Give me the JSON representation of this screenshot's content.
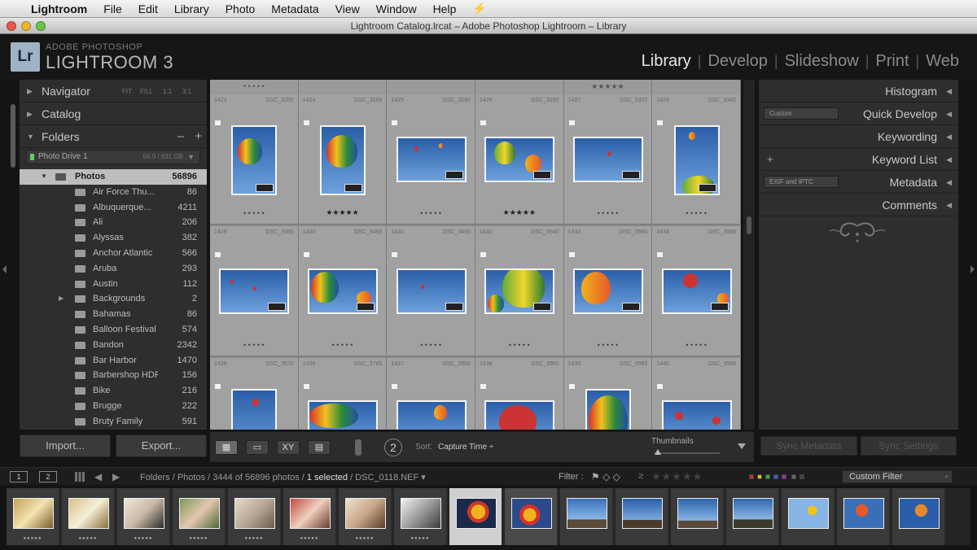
{
  "menubar": {
    "apple": "",
    "items": [
      "Lightroom",
      "File",
      "Edit",
      "Library",
      "Photo",
      "Metadata",
      "View",
      "Window",
      "Help"
    ],
    "extra": "⚡"
  },
  "window": {
    "title": "Lightroom Catalog.lrcat – Adobe Photoshop Lightroom – Library"
  },
  "identity": {
    "badge": "Lr",
    "top": "ADOBE PHOTOSHOP",
    "main": "LIGHTROOM 3"
  },
  "modules": [
    "Library",
    "Develop",
    "Slideshow",
    "Print",
    "Web"
  ],
  "left_panel": {
    "navigator": {
      "label": "Navigator",
      "zoom": [
        "FIT",
        "FILL",
        "1:1",
        "3:1"
      ]
    },
    "catalog": {
      "label": "Catalog"
    },
    "folders": {
      "label": "Folders",
      "minus": "–",
      "plus": "+"
    },
    "drive": {
      "name": "Photo Drive 1",
      "size": "56.9 / 931 GB"
    },
    "root": {
      "name": "Photos",
      "count": "56896"
    },
    "folders_list": [
      {
        "name": "Air Force Thu...",
        "count": "86"
      },
      {
        "name": "Albuquerque...",
        "count": "4211"
      },
      {
        "name": "Ali",
        "count": "206"
      },
      {
        "name": "Alyssas",
        "count": "382"
      },
      {
        "name": "Anchor Atlantic",
        "count": "566"
      },
      {
        "name": "Aruba",
        "count": "293"
      },
      {
        "name": "Austin",
        "count": "112"
      },
      {
        "name": "Backgrounds",
        "count": "2"
      },
      {
        "name": "Bahamas",
        "count": "86"
      },
      {
        "name": "Balloon Festival",
        "count": "574"
      },
      {
        "name": "Bandon",
        "count": "2342"
      },
      {
        "name": "Bar Harbor",
        "count": "1470"
      },
      {
        "name": "Barbershop HDR",
        "count": "156"
      },
      {
        "name": "Bike",
        "count": "216"
      },
      {
        "name": "Brugge",
        "count": "222"
      },
      {
        "name": "Bruty Family",
        "count": "591"
      }
    ],
    "import_label": "Import...",
    "export_label": "Export..."
  },
  "right_panel": {
    "histogram": "Histogram",
    "quick_develop": "Quick Develop",
    "quick_develop_preset": "Custom",
    "keywording": "Keywording",
    "keyword_list": "Keyword List",
    "metadata": "Metadata",
    "metadata_preset": "EXIF and IPTC",
    "comments": "Comments",
    "sync_metadata": "Sync Metadata",
    "sync_settings": "Sync Settings"
  },
  "grid": {
    "top_strip": [
      "• • • • •",
      "",
      "",
      "",
      "★★★★★",
      ""
    ],
    "rows": [
      [
        {
          "num": "1423",
          "name": "DSC_3255",
          "stars": "• • • • •"
        },
        {
          "num": "1424",
          "name": "DSC_3265",
          "stars": "★★★★★"
        },
        {
          "num": "1425",
          "name": "DSC_3280",
          "stars": "• • • • •"
        },
        {
          "num": "1426",
          "name": "DSC_3290",
          "stars": "★★★★★"
        },
        {
          "num": "1427",
          "name": "DSC_3320",
          "stars": "• • • • •"
        },
        {
          "num": "1428",
          "name": "DSC_3345",
          "stars": "• • • • •"
        }
      ],
      [
        {
          "num": "1429",
          "name": "DSC_3365",
          "stars": "• • • • •"
        },
        {
          "num": "1430",
          "name": "DSC_3485",
          "stars": "• • • • •"
        },
        {
          "num": "1431",
          "name": "DSC_3495",
          "stars": "• • • • •"
        },
        {
          "num": "1432",
          "name": "DSC_3540",
          "stars": "• • • • •"
        },
        {
          "num": "1433",
          "name": "DSC_3560",
          "stars": "• • • • •"
        },
        {
          "num": "1434",
          "name": "DSC_3565",
          "stars": "• • • • •"
        }
      ],
      [
        {
          "num": "1435",
          "name": "DSC_3570",
          "stars": ""
        },
        {
          "num": "1436",
          "name": "DSC_3785",
          "stars": ""
        },
        {
          "num": "1437",
          "name": "DSC_3900",
          "stars": ""
        },
        {
          "num": "1438",
          "name": "DSC_3960",
          "stars": ""
        },
        {
          "num": "1439",
          "name": "DSC_3965",
          "stars": ""
        },
        {
          "num": "1440",
          "name": "DSC_3990",
          "stars": ""
        }
      ]
    ]
  },
  "toolbar": {
    "view_grid": "▦",
    "view_loupe": "▭",
    "view_compare": "XY",
    "view_survey": "▤",
    "badge": "2",
    "sort_label": "Sort:",
    "sort_value": "Capture Time ÷",
    "thumbnails_label": "Thumbnails",
    "thumbnail_size": 0.05
  },
  "filmbar": {
    "screen1": "1",
    "screen2": "2",
    "crumb_prefix": "Folders / Photos / 3444 of 56896 photos / ",
    "crumb_selected": "1 selected",
    "crumb_file": " / DSC_0118.NEF ▾",
    "filter_label": "Filter :",
    "ge": "≥",
    "stars": "★★★★★",
    "custom_filter": "Custom Filter"
  },
  "colors": {
    "accent_swatches": [
      "#c83232",
      "#d8c229",
      "#3aa63a",
      "#3a62c8",
      "#8a3ab8"
    ]
  }
}
